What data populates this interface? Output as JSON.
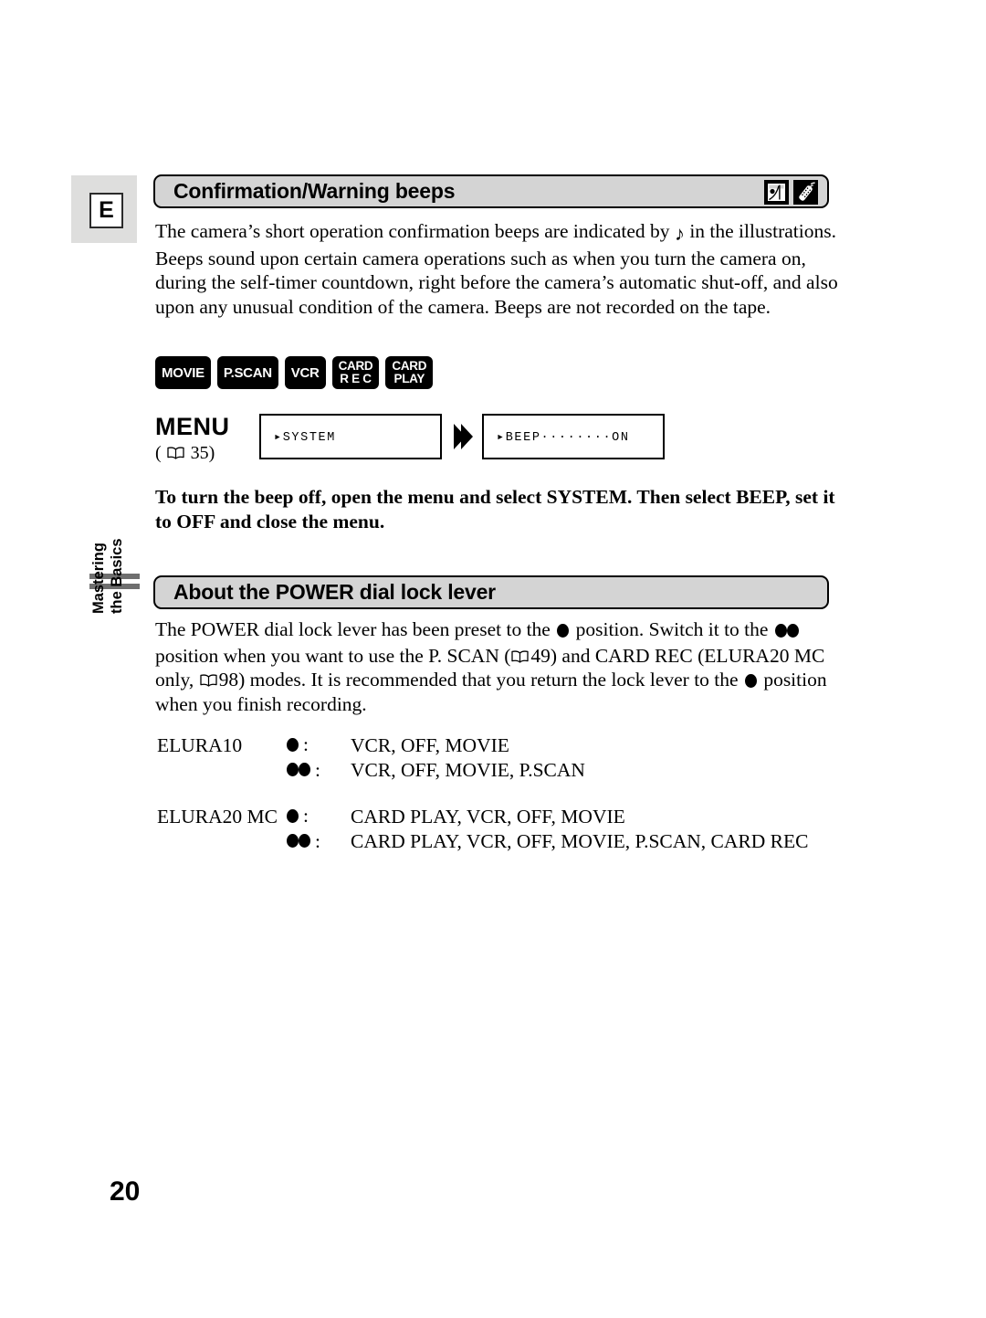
{
  "page": {
    "number": "20",
    "language_badge": "E"
  },
  "side_tab": {
    "line1": "Mastering",
    "line2": "the Basics"
  },
  "sections": [
    {
      "id": "confirmation-warning-beeps",
      "title": "Confirmation/Warning beeps",
      "icons": [
        "camcorder-icon",
        "remote-control-icon"
      ],
      "paragraph_parts": {
        "a": "The camera’s short operation confirmation beeps are indicated by ",
        "note_glyph": "♪",
        "b": " in the illustrations. Beeps sound upon certain camera operations such as when you turn the camera on, during the self-timer countdown, right before the camera’s automatic shut-off, and also upon any unusual condition of the camera. Beeps are not recorded on the tape."
      },
      "bold_note": "To turn the beep off, open the menu and select SYSTEM. Then select BEEP, set it to OFF and close the menu."
    },
    {
      "id": "about-power-dial-lock-lever",
      "title": "About the POWER dial lock lever",
      "paragraph_parts": {
        "a": "The POWER dial lock lever has been preset to the ",
        "b": " position. Switch it to the ",
        "c": " position when you want to use the P. SCAN (",
        "ref1": "49",
        "d": ") and CARD REC (ELURA20 MC only, ",
        "ref2": "98",
        "e": ") modes. It is recommended that you return the lock lever to the ",
        "f": " position when you finish recording."
      }
    }
  ],
  "mode_badges": [
    {
      "name": "movie",
      "lines": [
        "MOVIE"
      ]
    },
    {
      "name": "p-scan",
      "lines": [
        "P.SCAN"
      ]
    },
    {
      "name": "vcr",
      "lines": [
        "VCR"
      ]
    },
    {
      "name": "card-rec",
      "lines": [
        "CARD",
        "R E C"
      ]
    },
    {
      "name": "card-play",
      "lines": [
        "CARD",
        "PLAY"
      ]
    }
  ],
  "menu": {
    "label": "MENU",
    "ref_open": "(",
    "ref_page": "35",
    "ref_close": ")",
    "book_icon": "open-book-icon",
    "arrow_icon": "double-chevron-right-icon",
    "steps": [
      {
        "name": "system",
        "text": "▸SYSTEM"
      },
      {
        "name": "beep",
        "text": "▸BEEP········ON"
      }
    ]
  },
  "elura_table": {
    "rows": [
      {
        "model": "ELURA10",
        "position": "one-dot",
        "modes": "VCR, OFF, MOVIE"
      },
      {
        "model": "",
        "position": "two-dot",
        "modes": "VCR, OFF, MOVIE, P.SCAN"
      },
      {
        "model": "ELURA20 MC",
        "position": "one-dot",
        "modes": "CARD PLAY, VCR, OFF, MOVIE"
      },
      {
        "model": "",
        "position": "two-dot",
        "modes": "CARD PLAY, VCR, OFF, MOVIE, P.SCAN, CARD REC"
      }
    ]
  },
  "colors": {
    "header_bar": "#d4d4d4",
    "badge_bg": "#dededd",
    "side_bar": "#6f6f6f",
    "text": "#000000"
  }
}
